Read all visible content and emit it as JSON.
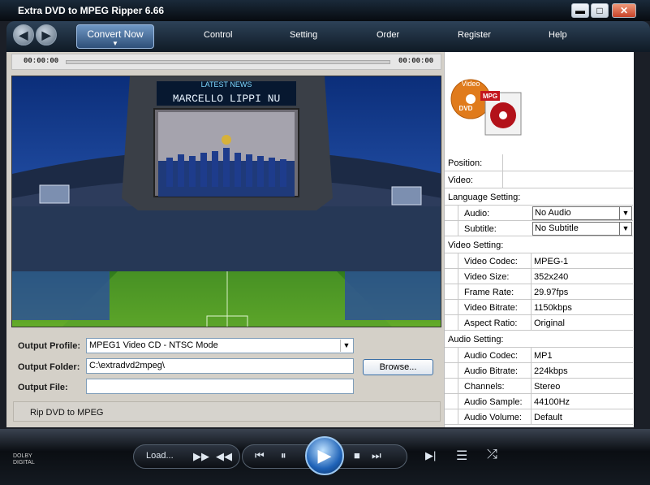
{
  "window": {
    "title": "Extra DVD to MPEG Ripper 6.66",
    "min": "▬",
    "max": "□",
    "close": "✕"
  },
  "nav": {
    "back": "◀",
    "forward": "▶",
    "active_tab": "Convert Now",
    "active_arrow": "▼",
    "items": [
      "Control",
      "Setting",
      "Order",
      "Register",
      "Help"
    ]
  },
  "player": {
    "time_start": "00:00:00",
    "time_end": "00:00:00",
    "progress": 0,
    "video_banner_top": "LATEST NEWS",
    "video_banner_name": "MARCELLO LIPPI NU"
  },
  "form": {
    "profile_label": "Output Profile:",
    "profile_value": "MPEG1  Video CD - NTSC Mode",
    "folder_label": "Output Folder:",
    "folder_value": "C:\\extradvd2mpeg\\",
    "file_label": "Output File:",
    "file_value": "",
    "browse": "Browse..."
  },
  "status": "Rip DVD to MPEG",
  "info": {
    "position_label": "Position:",
    "video_label": "Video:",
    "language_header": "Language Setting:",
    "audio_label": "Audio:",
    "audio_value": "No Audio",
    "subtitle_label": "Subtitle:",
    "subtitle_value": "No Subtitle",
    "video_header": "Video Setting:",
    "video_rows": [
      {
        "label": "Video Codec:",
        "value": "MPEG-1"
      },
      {
        "label": "Video Size:",
        "value": "352x240"
      },
      {
        "label": "Frame Rate:",
        "value": "29.97fps"
      },
      {
        "label": "Video Bitrate:",
        "value": "1150kbps"
      },
      {
        "label": "Aspect Ratio:",
        "value": "Original"
      }
    ],
    "audio_header": "Audio Setting:",
    "audio_rows": [
      {
        "label": "Audio Codec:",
        "value": "MP1"
      },
      {
        "label": "Audio Bitrate:",
        "value": "224kbps"
      },
      {
        "label": "Channels:",
        "value": "Stereo"
      },
      {
        "label": "Audio Sample:",
        "value": "44100Hz"
      },
      {
        "label": "Audio Volume:",
        "value": "Default"
      }
    ]
  },
  "logo": {
    "dvd_text": "Video",
    "dvd_sub": "DVD",
    "mpg_text": "MPG"
  },
  "controls": {
    "load": "Load...",
    "fast_forward": "▶▶",
    "rewind": "◀◀",
    "prev": "⏮",
    "pause": "⏸",
    "play": "▶",
    "stop": "■",
    "next": "⏭",
    "step": "▶|",
    "playlist": "☰",
    "shuffle": "⤮",
    "dolby": "DOLBY DIGITAL"
  }
}
